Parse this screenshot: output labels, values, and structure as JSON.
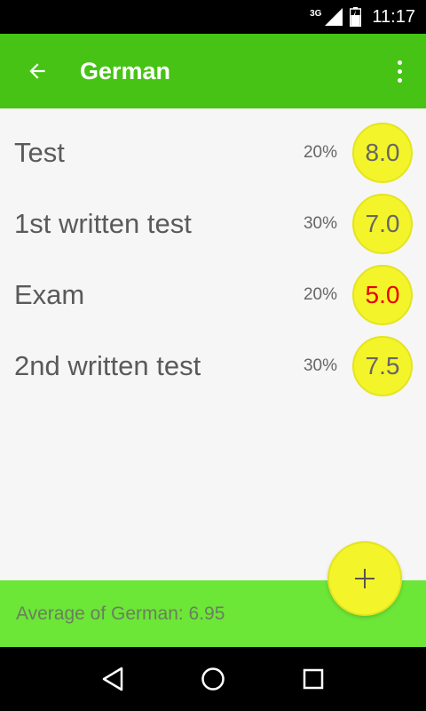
{
  "status_bar": {
    "network": "3G",
    "time": "11:17"
  },
  "app_bar": {
    "title": "German"
  },
  "grades": [
    {
      "name": "Test",
      "weight": "20%",
      "grade": "8.0",
      "failing": false
    },
    {
      "name": "1st written test",
      "weight": "30%",
      "grade": "7.0",
      "failing": false
    },
    {
      "name": "Exam",
      "weight": "20%",
      "grade": "5.0",
      "failing": true
    },
    {
      "name": "2nd written test",
      "weight": "30%",
      "grade": "7.5",
      "failing": false
    }
  ],
  "footer": {
    "average_text": "Average of German: 6.95"
  },
  "icons": {
    "back": "arrow-back-icon",
    "overflow": "more-vert-icon",
    "add": "add-icon",
    "nav_back": "triangle-back-icon",
    "nav_home": "circle-home-icon",
    "nav_recents": "square-recents-icon"
  },
  "colors": {
    "app_bar": "#46c314",
    "footer": "#6ce637",
    "grade_circle": "#f4f42a",
    "failing_grade_text": "#e80000"
  }
}
